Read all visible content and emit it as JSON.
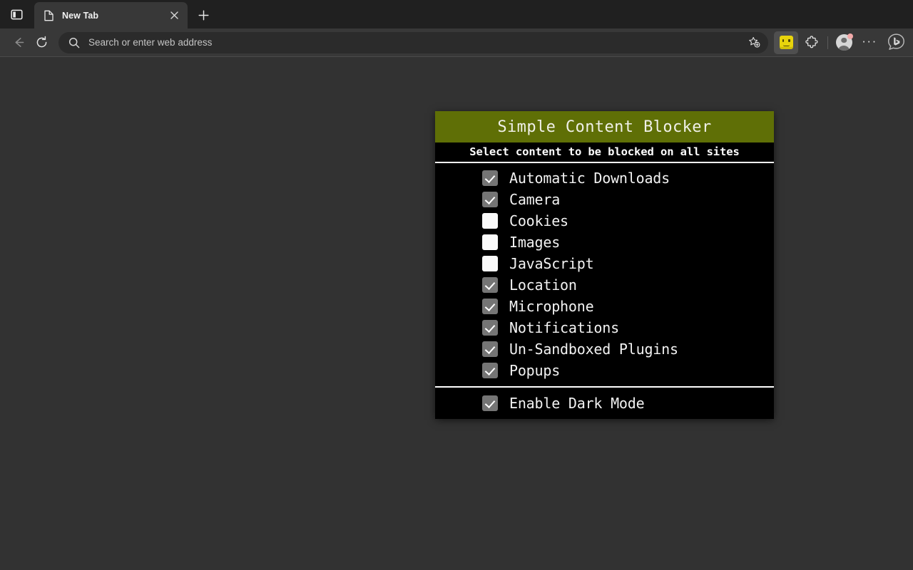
{
  "browser": {
    "tabstrip": {
      "tab_actions_icon": "sidebar-panel-icon",
      "tab_actions_title": "Tab actions menu",
      "tabs": [
        {
          "title": "New Tab",
          "favicon": "page-icon",
          "close_label": "Close tab"
        }
      ],
      "new_tab_label": "New tab"
    },
    "toolbar": {
      "back_label": "Back",
      "refresh_label": "Refresh",
      "search_icon": "search-icon",
      "address_placeholder": "Search or enter web address",
      "address_value": "",
      "favorite_label": "Add this page to favorites",
      "extension_icon": "lego-head-icon",
      "extension_label": "Simple Content Blocker",
      "extensions_label": "Extensions",
      "profile_label": "Profile",
      "settings_label": "Settings and more",
      "settings_glyph": "···",
      "copilot_label": "Copilot"
    }
  },
  "popup": {
    "title": "Simple Content Blocker",
    "subtitle": "Select content to be blocked on all sites",
    "header_color": "#5f6f06",
    "background_color": "#000000",
    "text_color": "#f2f2f2",
    "checked_box_color": "#757575",
    "unchecked_box_color": "#fafafa",
    "options": [
      {
        "label": "Automatic Downloads",
        "checked": true
      },
      {
        "label": "Camera",
        "checked": true
      },
      {
        "label": "Cookies",
        "checked": false
      },
      {
        "label": "Images",
        "checked": false
      },
      {
        "label": "JavaScript",
        "checked": false
      },
      {
        "label": "Location",
        "checked": true
      },
      {
        "label": "Microphone",
        "checked": true
      },
      {
        "label": "Notifications",
        "checked": true
      },
      {
        "label": "Un-Sandboxed Plugins",
        "checked": true
      },
      {
        "label": "Popups",
        "checked": true
      }
    ],
    "footer": {
      "label": "Enable Dark Mode",
      "checked": true
    }
  }
}
